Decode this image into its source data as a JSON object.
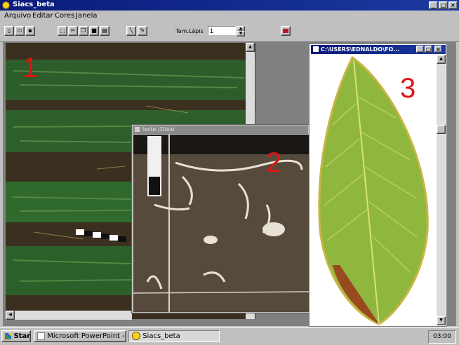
{
  "window": {
    "title": "Siacs_beta"
  },
  "menu": [
    "Arquivo",
    "Editar",
    "Cores",
    "Janela"
  ],
  "toolbar": {
    "label": "Tam.Lápis",
    "value": "1"
  },
  "windows": {
    "w1": {
      "label": "1"
    },
    "w2": {
      "title": "leste (Dialo",
      "label": "2"
    },
    "w3": {
      "title": "C:\\USERS\\EDNALDO\\FO...",
      "label": "3"
    }
  },
  "taskbar": {
    "start": "Start",
    "items": [
      "Microsoft PowerPoint - [Pr...",
      "Siacs_beta"
    ],
    "time": "03:00"
  },
  "colors": {
    "title_active": "#0a1a7a",
    "number_red": "#e01414",
    "desktop": "#c0c0c0"
  }
}
